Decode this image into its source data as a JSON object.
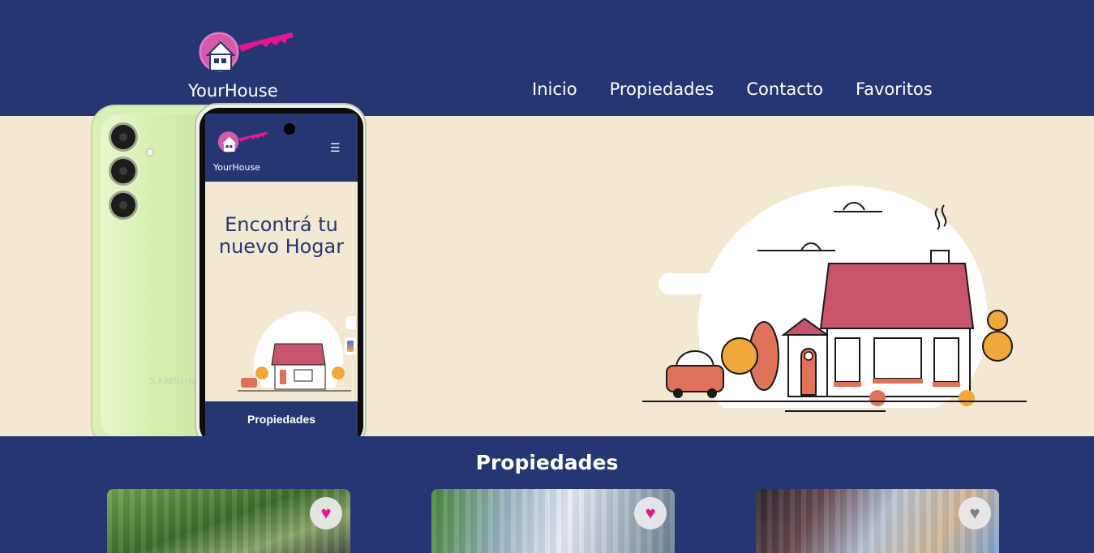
{
  "header": {
    "brand_name": "YourHouse",
    "nav": [
      {
        "label": "Inicio"
      },
      {
        "label": "Propiedades"
      },
      {
        "label": "Contacto"
      },
      {
        "label": "Favoritos"
      }
    ]
  },
  "hero": {
    "title_visible": "nuevo"
  },
  "phone": {
    "brand_name": "YourHouse",
    "menu_icon": "☰",
    "title": "Encontrá tu nuevo Hogar",
    "section_title": "Propiedades",
    "back_label": "SAMSUNG"
  },
  "properties": {
    "title": "Propiedades",
    "cards": [
      {
        "favorite": true,
        "icon": "heart-icon"
      },
      {
        "favorite": true,
        "icon": "heart-icon"
      },
      {
        "favorite": false,
        "icon": "heart-icon"
      }
    ]
  },
  "colors": {
    "navy": "#263673",
    "cream": "#f3e8d2",
    "accent_pink": "#e8168c",
    "roof": "#c8546c"
  }
}
